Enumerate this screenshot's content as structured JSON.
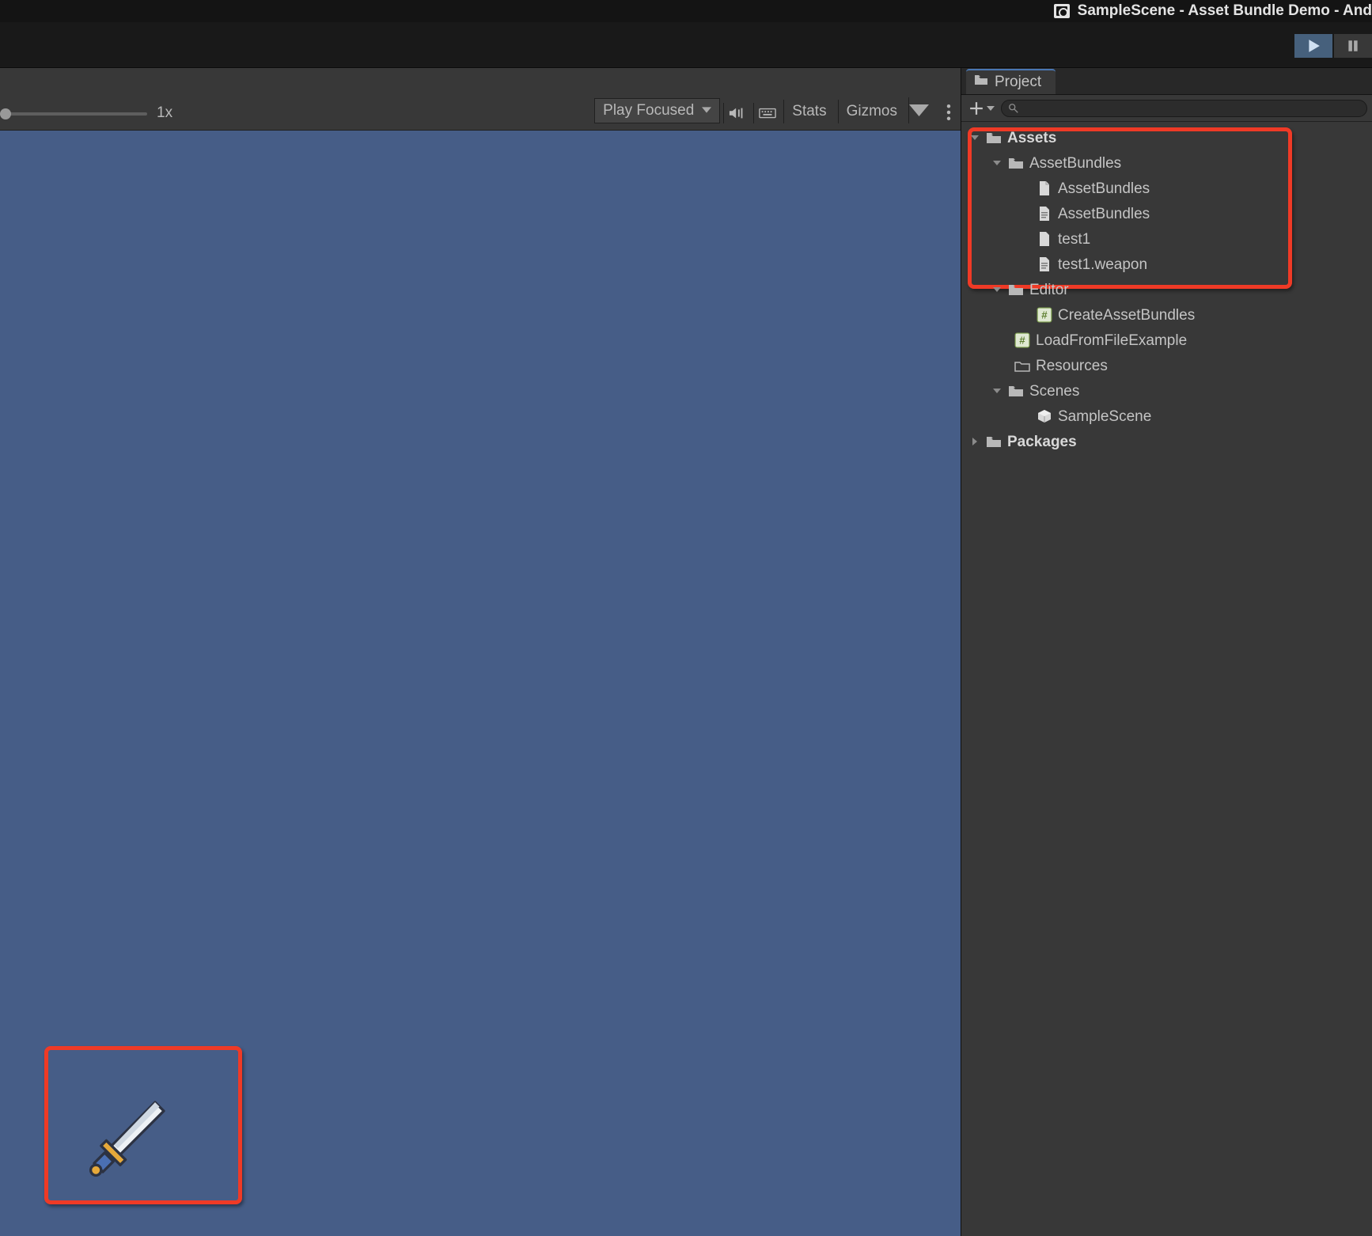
{
  "titlebar": {
    "text": "SampleScene - Asset Bundle Demo - And"
  },
  "play_controls": {
    "play": "Play",
    "pause": "Pause"
  },
  "game_toolbar": {
    "scale_label": "1x",
    "play_focused": "Play Focused",
    "stats": "Stats",
    "gizmos": "Gizmos"
  },
  "project_tab": {
    "label": "Project"
  },
  "tree": {
    "assets": "Assets",
    "assetbundles_folder": "AssetBundles",
    "assetbundles_file1": "AssetBundles",
    "assetbundles_file2": "AssetBundles",
    "test1": "test1",
    "test1weapon": "test1.weapon",
    "editor": "Editor",
    "createab": "CreateAssetBundles",
    "loadfile": "LoadFromFileExample",
    "resources": "Resources",
    "scenes": "Scenes",
    "samplescene": "SampleScene",
    "packages": "Packages"
  }
}
